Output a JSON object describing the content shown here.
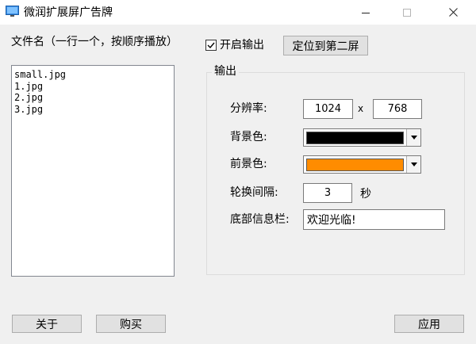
{
  "window": {
    "title": "微润扩展屏广告牌"
  },
  "file_list": {
    "label": "文件名（一行一个，按顺序播放）",
    "items": [
      "small.jpg",
      "1.jpg",
      "2.jpg",
      "3.jpg"
    ]
  },
  "output_toggle": {
    "label": "开启输出",
    "checked": true
  },
  "locate_button": {
    "label": "定位到第二屏"
  },
  "output_group": {
    "title": "输出",
    "resolution": {
      "label": "分辨率:",
      "width": "1024",
      "separator": "x",
      "height": "768"
    },
    "background_color": {
      "label": "背景色:",
      "value": "#000000"
    },
    "foreground_color": {
      "label": "前景色:",
      "value": "#ff8c00"
    },
    "interval": {
      "label": "轮换间隔:",
      "value": "3",
      "unit": "秒"
    },
    "footer_info": {
      "label": "底部信息栏:",
      "value": "欢迎光临!"
    }
  },
  "buttons": {
    "about": "关于",
    "buy": "购买",
    "apply": "应用"
  }
}
